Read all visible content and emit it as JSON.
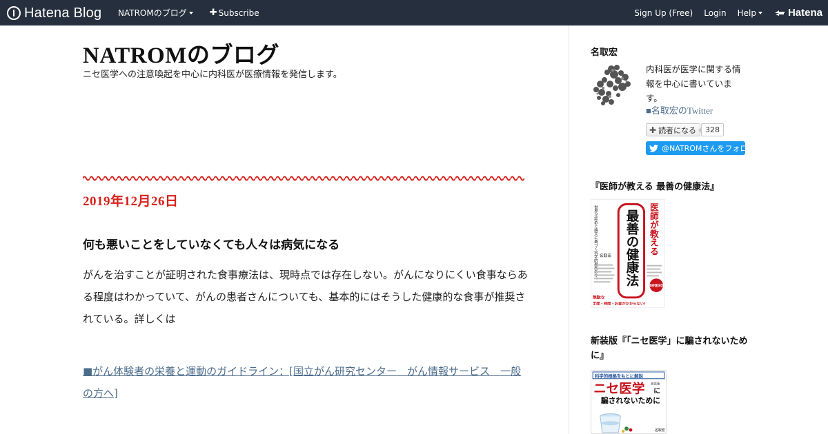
{
  "topbar": {
    "brand": "Hatena Blog",
    "blog_menu": "NATROMのブログ",
    "subscribe": "Subscribe",
    "signup": "Sign Up (Free)",
    "login": "Login",
    "help": "Help",
    "hatena": "Hatena"
  },
  "blog": {
    "title": "NATROMのブログ",
    "description": "ニセ医学への注意喚起を中心に内科医が医療情報を発信します。"
  },
  "entry": {
    "date": "2019年12月26日",
    "title": "何も悪いことをしていなくても人々は病気になる",
    "body": "がんを治すことが証明された食事療法は、現時点では存在しない。がんになりにくい食事ならある程度はわかっていて、がんの患者さんについても、基本的にはそうした健康的な食事が推奨されている。詳しくは",
    "link": "■がん体験者の栄養と運動のガイドライン：[国立がん研究センター　がん情報サービス　一般の方へ]"
  },
  "sidebar": {
    "profile": {
      "heading": "名取宏",
      "text": "内科医が医学に関する情報を中心に書いています。",
      "twitter_link": "■名取宏のTwitter",
      "subscribe_label": "読者になる",
      "reader_count": "328",
      "follow_label": "@NATROMさんをフォロー"
    },
    "book1": {
      "heading": "『医師が教える 最善の健康法』",
      "cover": {
        "title_big": "最善の健康法",
        "title_side": "医師が教える",
        "blurb": "世界が認めた論文に基づく科学的根拠あり！",
        "author": "名取宏",
        "badge": "保存版決定",
        "bottom_line1": "無駄な",
        "bottom_line2": "手間・時間・お金がかからない!"
      }
    },
    "book2": {
      "heading": "新装版『「ニセ医学」に騙されないために』",
      "cover": {
        "top_banner": "科学的根拠をもとに解説",
        "edition": "新装版",
        "title_main": "ニセ医学",
        "title_ni": "に",
        "title_sub": "騙されないために",
        "author": "名取宏"
      }
    }
  },
  "colors": {
    "topbar_bg": "#252f3d",
    "accent_red": "#d8221b",
    "link": "#4c6c8c",
    "twitter_blue": "#1d9bf0",
    "book_red": "#c8141e",
    "book_blue": "#1f4f9a"
  }
}
